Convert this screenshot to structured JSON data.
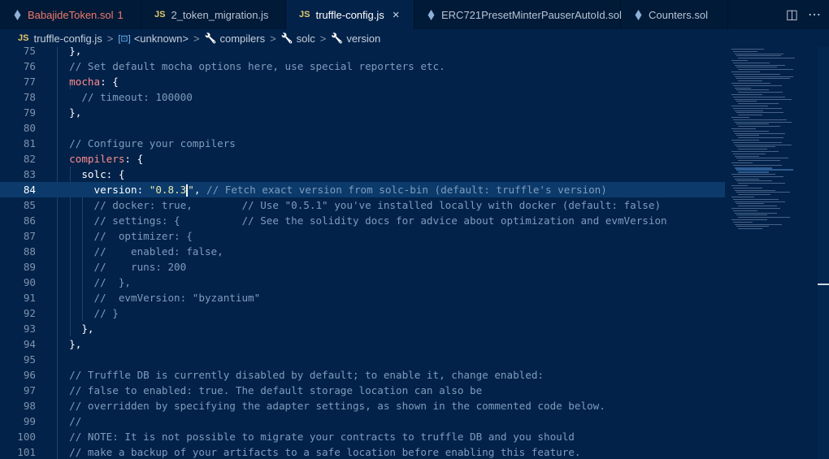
{
  "tabs": [
    {
      "label": "BabajideToken.sol",
      "icon": "solidity-icon",
      "badge": "1",
      "state": "error"
    },
    {
      "label": "2_token_migration.js",
      "icon": "js-icon"
    },
    {
      "label": "truffle-config.js",
      "icon": "js-icon",
      "active": true,
      "close": "×"
    },
    {
      "label": "ERC721PresetMinterPauserAutoId.sol",
      "icon": "solidity-icon"
    },
    {
      "label": "Counters.sol",
      "icon": "solidity-icon"
    }
  ],
  "tab_actions": {
    "split": "◫",
    "more": "⋯"
  },
  "js_badge": "JS",
  "breadcrumb": {
    "file": "truffle-config.js",
    "items": [
      "<unknown>",
      "compilers",
      "solc",
      "version"
    ]
  },
  "lines": [
    {
      "n": "75",
      "segs": [
        [
          "p",
          "  },"
        ]
      ]
    },
    {
      "n": "76",
      "segs": [
        [
          "c",
          "  // Set default mocha options here, use special reporters etc."
        ]
      ]
    },
    {
      "n": "77",
      "segs": [
        [
          "p",
          "  "
        ],
        [
          "k",
          "mocha"
        ],
        [
          "p",
          ": {"
        ]
      ]
    },
    {
      "n": "78",
      "segs": [
        [
          "c",
          "    // timeout: 100000"
        ]
      ]
    },
    {
      "n": "79",
      "segs": [
        [
          "p",
          "  },"
        ]
      ]
    },
    {
      "n": "80",
      "segs": [
        [
          "p",
          ""
        ]
      ]
    },
    {
      "n": "81",
      "segs": [
        [
          "c",
          "  // Configure your compilers"
        ]
      ]
    },
    {
      "n": "82",
      "segs": [
        [
          "p",
          "  "
        ],
        [
          "k",
          "compilers"
        ],
        [
          "p",
          ": {"
        ]
      ]
    },
    {
      "n": "83",
      "segs": [
        [
          "p",
          "    solc: {"
        ]
      ]
    },
    {
      "n": "84",
      "current": true,
      "segs": [
        [
          "p",
          "      version: "
        ],
        [
          "s",
          "\"0.8.3"
        ],
        [
          "cursor",
          ""
        ],
        [
          "s",
          "\""
        ],
        [
          "p",
          ", "
        ],
        [
          "c",
          "// Fetch exact version from solc-bin (default: truffle's version)"
        ]
      ]
    },
    {
      "n": "85",
      "segs": [
        [
          "c",
          "      // docker: true,        // Use \"0.5.1\" you've installed locally with docker (default: false)"
        ]
      ]
    },
    {
      "n": "86",
      "segs": [
        [
          "c",
          "      // settings: {          // See the solidity docs for advice about optimization and evmVersion"
        ]
      ]
    },
    {
      "n": "87",
      "segs": [
        [
          "c",
          "      //  optimizer: {"
        ]
      ]
    },
    {
      "n": "88",
      "segs": [
        [
          "c",
          "      //    enabled: false,"
        ]
      ]
    },
    {
      "n": "89",
      "segs": [
        [
          "c",
          "      //    runs: 200"
        ]
      ]
    },
    {
      "n": "90",
      "segs": [
        [
          "c",
          "      //  },"
        ]
      ]
    },
    {
      "n": "91",
      "segs": [
        [
          "c",
          "      //  evmVersion: \"byzantium\""
        ]
      ]
    },
    {
      "n": "92",
      "segs": [
        [
          "c",
          "      // }"
        ]
      ]
    },
    {
      "n": "93",
      "segs": [
        [
          "p",
          "    },"
        ]
      ]
    },
    {
      "n": "94",
      "segs": [
        [
          "p",
          "  },"
        ]
      ]
    },
    {
      "n": "95",
      "segs": [
        [
          "p",
          ""
        ]
      ]
    },
    {
      "n": "96",
      "segs": [
        [
          "c",
          "  // Truffle DB is currently disabled by default; to enable it, change enabled:"
        ]
      ]
    },
    {
      "n": "97",
      "segs": [
        [
          "c",
          "  // false to enabled: true. The default storage location can also be"
        ]
      ]
    },
    {
      "n": "98",
      "segs": [
        [
          "c",
          "  // overridden by specifying the adapter settings, as shown in the commented code below."
        ]
      ]
    },
    {
      "n": "99",
      "segs": [
        [
          "c",
          "  //"
        ]
      ]
    },
    {
      "n": "100",
      "segs": [
        [
          "c",
          "  // NOTE: It is not possible to migrate your contracts to truffle DB and you should"
        ]
      ]
    },
    {
      "n": "101",
      "segs": [
        [
          "c",
          "  // make a backup of your artifacts to a safe location before enabling this feature."
        ]
      ]
    }
  ],
  "colors": {
    "background": "#022249",
    "comment": "#7f9cbd",
    "keyword": "#ff8c8c",
    "string": "#e8e8ac",
    "tab_error": "#f07a6a",
    "js_yellow": "#e5c76b",
    "current_line": "#0b3a6b"
  }
}
